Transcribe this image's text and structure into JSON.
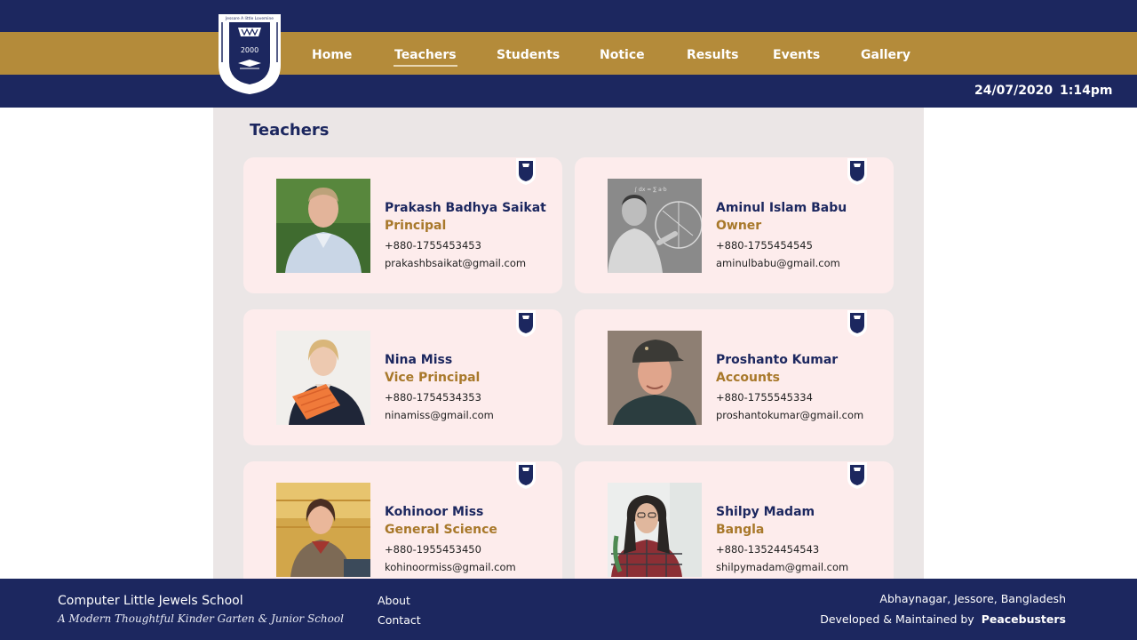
{
  "header": {
    "logo_text_top": "Jessore A little Lovemine",
    "logo_text_ring": "Computer Little Jewels School",
    "logo_year": "2000",
    "nav": [
      {
        "label": "Home"
      },
      {
        "label": "Teachers",
        "active": true
      },
      {
        "label": "Students"
      },
      {
        "label": "Notice"
      },
      {
        "label": "Results"
      },
      {
        "label": "Events"
      },
      {
        "label": "Gallery"
      }
    ],
    "date": "24/07/2020",
    "time": "1:14pm"
  },
  "main": {
    "title": "Teachers",
    "teachers": [
      {
        "name": "Prakash Badhya Saikat",
        "role": "Principal",
        "phone": "+880-1755453453",
        "email": "prakashbsaikat@gmail.com"
      },
      {
        "name": "Aminul Islam Babu",
        "role": "Owner",
        "phone": "+880-1755454545",
        "email": "aminulbabu@gmail.com"
      },
      {
        "name": "Nina Miss",
        "role": "Vice Principal",
        "phone": "+880-1754534353",
        "email": "ninamiss@gmail.com"
      },
      {
        "name": "Proshanto Kumar",
        "role": "Accounts",
        "phone": "+880-1755545334",
        "email": "proshantokumar@gmail.com"
      },
      {
        "name": "Kohinoor Miss",
        "role": "General Science",
        "phone": "+880-1955453450",
        "email": "kohinoormiss@gmail.com"
      },
      {
        "name": "Shilpy Madam",
        "role": "Bangla",
        "phone": "+880-13524454543",
        "email": "shilpymadam@gmail.com"
      }
    ]
  },
  "footer": {
    "school": "Computer Little Jewels School",
    "tagline": "A Modern Thoughtful Kinder Garten & Junior School",
    "links": [
      "About",
      "Contact"
    ],
    "address": "Abhaynagar, Jessore, Bangladesh",
    "developed_by": "Developed & Maintained by",
    "developer": "Peacebusters"
  },
  "colors": {
    "navy": "#1c275f",
    "gold": "#b48b3a",
    "card": "#fdecec",
    "content_bg": "#ebe6e6"
  }
}
